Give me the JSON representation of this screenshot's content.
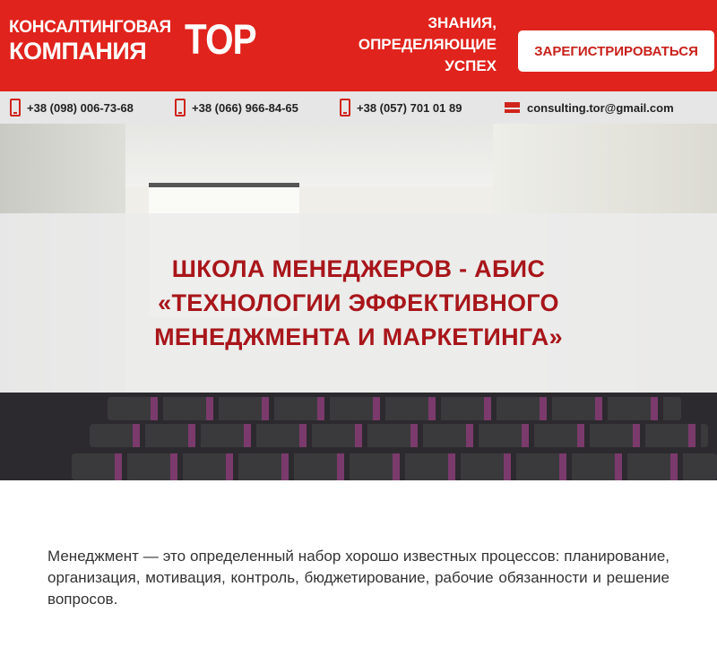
{
  "header": {
    "logo_line1": "КОНСАЛТИНГОВАЯ",
    "logo_line2": "КОМПАНИЯ",
    "logo_tor": "TOP",
    "slogan": [
      "ЗНАНИЯ,",
      "ОПРЕДЕЛЯЮЩИЕ",
      "УСПЕХ"
    ],
    "register_label": "ЗАРЕГИСТРИРОВАТЬСЯ"
  },
  "contacts": {
    "phone1": "+38 (098) 006-73-68",
    "phone2": "+38 (066) 966-84-65",
    "phone3": "+38 (057) 701 01 89",
    "email": "consulting.tor@gmail.com",
    "icons": [
      "phone-icon",
      "phone-icon",
      "phone-icon",
      "mail-icon"
    ]
  },
  "hero": {
    "title_lines": [
      "ШКОЛА МЕНЕДЖЕРОВ - АБИС",
      "«ТЕХНОЛОГИИ ЭФФЕКТИВНОГО",
      "МЕНЕДЖМЕНТА И МАРКЕТИНГА»"
    ]
  },
  "intro": {
    "text": "Менеджмент — это определенный набор хорошо известных процессов: планирование, организация, мотивация, контроль, бюджетирование, рабочие обязанности и решение вопросов."
  },
  "colors": {
    "brand_red": "#e0231c",
    "title_red": "#a8161a",
    "contact_bar": "#e6e6e6"
  }
}
